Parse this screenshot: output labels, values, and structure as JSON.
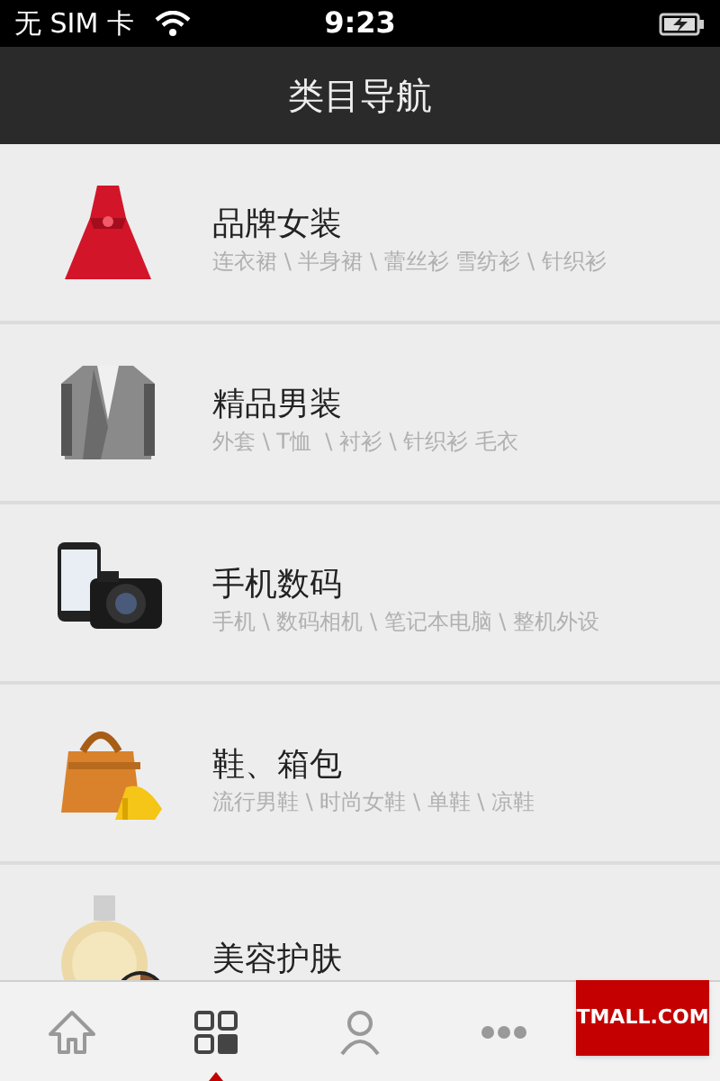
{
  "status_bar": {
    "carrier": "无 SIM 卡",
    "time": "9:23"
  },
  "header": {
    "title": "类目导航"
  },
  "categories": [
    {
      "kind": "dress",
      "title": "品牌女装",
      "subtitle": "连衣裙 \\ 半身裙 \\ 蕾丝衫 雪纺衫 \\ 针织衫"
    },
    {
      "kind": "jacket",
      "title": "精品男装",
      "subtitle": "外套 \\ T恤  \\ 衬衫 \\ 针织衫 毛衣"
    },
    {
      "kind": "camera",
      "title": "手机数码",
      "subtitle": "手机 \\ 数码相机 \\ 笔记本电脑 \\ 整机外设"
    },
    {
      "kind": "bag",
      "title": "鞋、箱包",
      "subtitle": "流行男鞋 \\ 时尚女鞋 \\ 单鞋 \\ 凉鞋"
    },
    {
      "kind": "perfume",
      "title": "美容护肤"
    }
  ],
  "tab_bar": [
    {
      "kind": "home",
      "selected": false
    },
    {
      "kind": "grid",
      "selected": true
    },
    {
      "kind": "user",
      "selected": false
    },
    {
      "kind": "more",
      "selected": false
    }
  ],
  "badge": {
    "label": "TMALL.COM"
  }
}
